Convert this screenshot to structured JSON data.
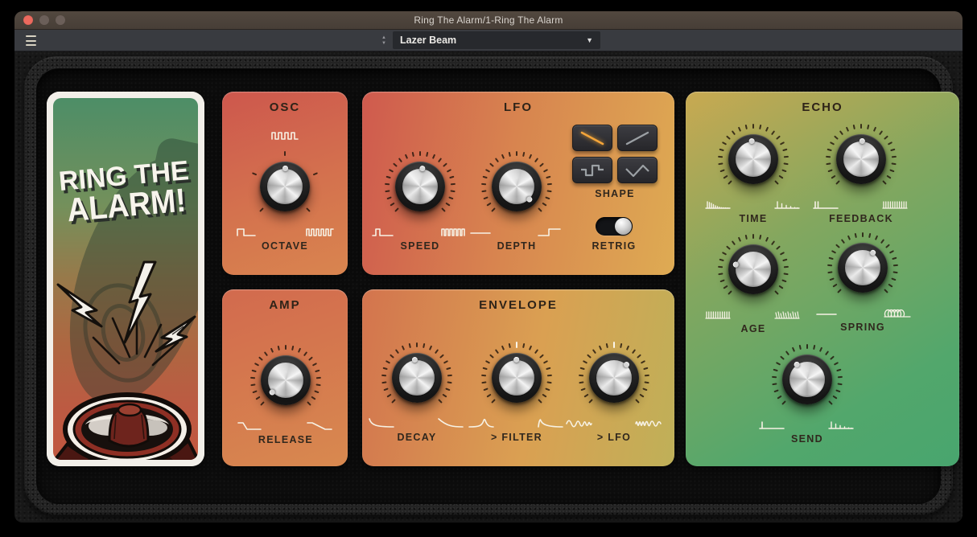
{
  "window": {
    "title": "Ring The Alarm/1-Ring The Alarm"
  },
  "toolbar": {
    "menu_icon": "hamburger-icon",
    "stepper_up": "▲",
    "stepper_down": "▼",
    "preset_name": "Lazer Beam",
    "dropdown_caret": "▼"
  },
  "poster": {
    "title_line1": "RING THE",
    "title_line2": "ALARM!",
    "art": "megaphone-lightning-illustration"
  },
  "panels": {
    "osc": {
      "title": "OSC",
      "knob": {
        "label": "OCTAVE",
        "value_angle": 0,
        "ticks": 5,
        "center_marker": false,
        "icon_top": "square-wave",
        "icon_left": "square-wave-wide",
        "icon_right": "square-wave-dense"
      }
    },
    "lfo": {
      "title": "LFO",
      "knobs": [
        {
          "label": "SPEED",
          "value_angle": 6,
          "ticks": 23,
          "center_marker": false,
          "icon_left": "pulse-single",
          "icon_right": "pulse-train"
        },
        {
          "label": "DEPTH",
          "value_angle": 134,
          "ticks": 23,
          "center_marker": false,
          "icon_left": "flat-line",
          "icon_right": "step-up"
        }
      ],
      "shape": {
        "label": "SHAPE",
        "buttons": [
          {
            "icon": "saw-down",
            "selected": true
          },
          {
            "icon": "saw-up",
            "selected": false
          },
          {
            "icon": "square",
            "selected": false
          },
          {
            "icon": "triangle",
            "selected": false
          }
        ]
      },
      "retrig": {
        "label": "RETRIG",
        "on": true
      }
    },
    "amp": {
      "title": "AMP",
      "knob": {
        "label": "RELEASE",
        "value_angle": -133,
        "ticks": 23,
        "center_marker": false,
        "icon_left": "release-fast",
        "icon_right": "release-slow"
      }
    },
    "envelope": {
      "title": "ENVELOPE",
      "knobs": [
        {
          "label": "DECAY",
          "value_angle": -8,
          "ticks": 23,
          "center_marker": false,
          "icon_left": "decay-fast",
          "icon_right": "decay-slow"
        },
        {
          "label": "> FILTER",
          "value_angle": -2,
          "ticks": 23,
          "center_marker": true,
          "icon_left": "ramp-peak",
          "icon_right": "pluck-decay"
        },
        {
          "label": "> LFO",
          "value_angle": 42,
          "ticks": 23,
          "center_marker": true,
          "icon_left": "wave-accel",
          "icon_right": "wave-dense"
        }
      ]
    },
    "echo": {
      "title": "ECHO",
      "knobs": [
        {
          "label": "TIME",
          "value_angle": -6,
          "ticks": 23,
          "center_marker": false,
          "icon_left": "ticks-decay-dense",
          "icon_right": "ticks-decay-sparse"
        },
        {
          "label": "FEEDBACK",
          "value_angle": 2,
          "ticks": 23,
          "center_marker": false,
          "icon_left": "ticks-two",
          "icon_right": "comb-even"
        },
        {
          "label": "AGE",
          "value_angle": -76,
          "ticks": 23,
          "center_marker": false,
          "icon_left": "comb-even",
          "icon_right": "comb-rough"
        },
        {
          "label": "SPRING",
          "value_angle": 33,
          "ticks": 23,
          "center_marker": false,
          "icon_left": "flat-line",
          "icon_right": "spring-coil"
        },
        {
          "label": "SEND",
          "value_angle": -36,
          "ticks": 23,
          "center_marker": false,
          "icon_left": "tick-one",
          "icon_right": "ticks-decay-sparse"
        }
      ]
    }
  },
  "colors": {
    "accent_selected_shape": "#f4a53a",
    "panel_red": "#cd574d",
    "panel_orange": "#d8854f",
    "panel_yellow": "#deab53",
    "panel_green": "#48a56e",
    "titlebar": "#4c433c",
    "toolbar": "#393b40",
    "close_light": "#ed6a5e"
  }
}
